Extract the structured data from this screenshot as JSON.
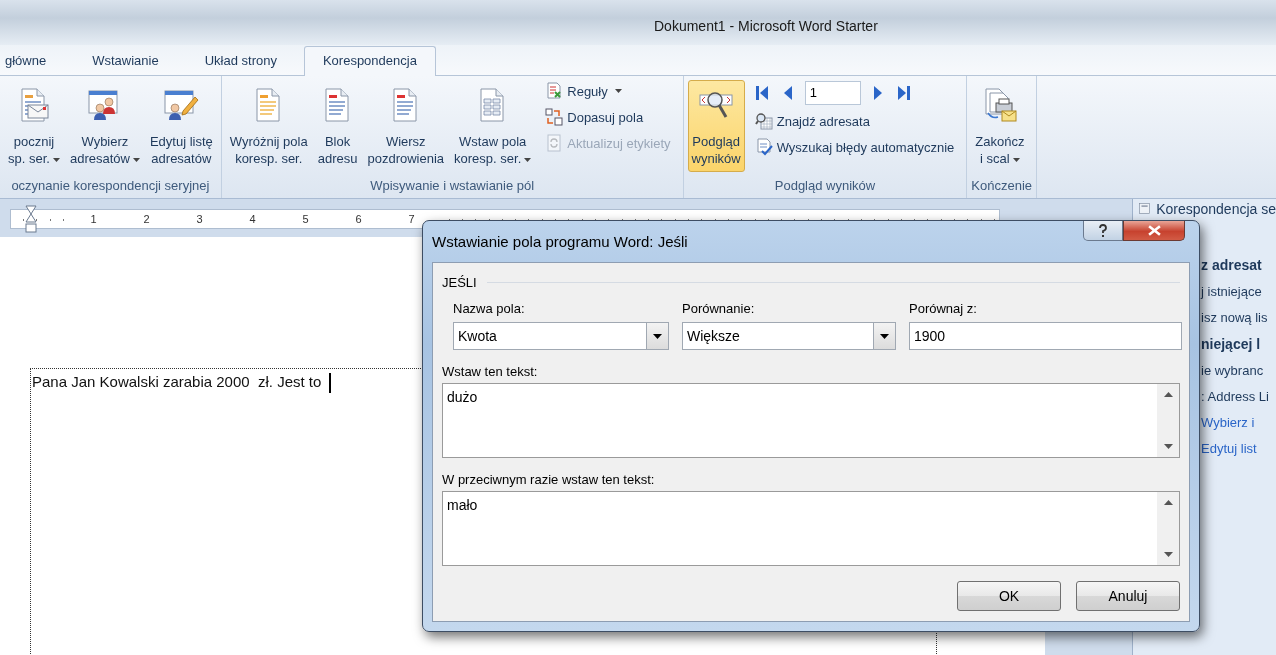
{
  "window": {
    "title": "Dokument1  -  Microsoft Word Starter"
  },
  "tabs": [
    {
      "label": "główne",
      "selected": false
    },
    {
      "label": "Wstawianie",
      "selected": false
    },
    {
      "label": "Układ strony",
      "selected": false
    },
    {
      "label": "Korespondencja",
      "selected": true
    }
  ],
  "ribbon": {
    "groups": [
      {
        "label": "oczynanie korespondencji seryjnej",
        "items": [
          {
            "kind": "large",
            "lines": [
              "pocznij",
              "sp. ser."
            ],
            "dropdown": true,
            "on": false
          },
          {
            "kind": "large",
            "lines": [
              "Wybierz",
              "adresatów"
            ],
            "dropdown": true,
            "on": false
          },
          {
            "kind": "large",
            "lines": [
              "Edytuj listę",
              "adresatów"
            ],
            "dropdown": false,
            "on": false
          }
        ]
      },
      {
        "label": "Wpisywanie i wstawianie pól",
        "items": [
          {
            "kind": "large",
            "lines": [
              "Wyróżnij pola",
              "koresp. ser."
            ],
            "dropdown": false,
            "on": false
          },
          {
            "kind": "large",
            "lines": [
              "Blok",
              "adresu"
            ],
            "dropdown": false,
            "on": false
          },
          {
            "kind": "large",
            "lines": [
              "Wiersz",
              "pozdrowienia"
            ],
            "dropdown": false,
            "on": false
          },
          {
            "kind": "large",
            "lines": [
              "Wstaw pola",
              "koresp. ser."
            ],
            "dropdown": true,
            "on": false
          },
          {
            "kind": "small",
            "label": "Reguły",
            "dropdown": true,
            "disabled": false
          },
          {
            "kind": "small",
            "label": "Dopasuj pola",
            "dropdown": false,
            "disabled": false
          },
          {
            "kind": "small",
            "label": "Aktualizuj etykiety",
            "dropdown": false,
            "disabled": true
          }
        ]
      },
      {
        "label": "Podgląd wyników",
        "items": [
          {
            "kind": "large",
            "lines": [
              "Podgląd",
              "wyników"
            ],
            "dropdown": false,
            "on": true
          },
          {
            "kind": "pager",
            "value": "1"
          },
          {
            "kind": "small",
            "label": "Znajdź adresata",
            "dropdown": false,
            "disabled": false
          },
          {
            "kind": "small",
            "label": "Wyszukaj błędy automatycznie",
            "dropdown": false,
            "disabled": false
          }
        ]
      },
      {
        "label": "Kończenie",
        "items": [
          {
            "kind": "large",
            "lines": [
              "Zakończ",
              "i scal"
            ],
            "dropdown": true,
            "on": false
          }
        ]
      }
    ]
  },
  "ruler": {
    "numbers": [
      "1",
      "2",
      "3",
      "4",
      "5",
      "6",
      "7"
    ]
  },
  "document": {
    "text": "Pana Jan Kowalski zarabia 2000  zł. Jest to"
  },
  "task_pane": {
    "title": "Korespondencja se",
    "lines": [
      {
        "kind": "heading",
        "text": "z adresat"
      },
      {
        "kind": "text",
        "text": "j istniejące"
      },
      {
        "kind": "text",
        "text": "isz nową lis"
      },
      {
        "kind": "heading",
        "text": "niejącej l"
      },
      {
        "kind": "text",
        "text": "ie wybranc"
      },
      {
        "kind": "text",
        "text": ": Address Li"
      },
      {
        "kind": "link",
        "text": "Wybierz i"
      },
      {
        "kind": "link",
        "text": "Edytuj list"
      }
    ]
  },
  "dialog": {
    "title": "Wstawianie pola programu Word: Jeśli",
    "group_label": "JEŚLI",
    "fields": [
      {
        "kind": "combo",
        "label": "Nazwa pola:",
        "value": "Kwota"
      },
      {
        "kind": "combo",
        "label": "Porównanie:",
        "value": "Większe"
      },
      {
        "kind": "text",
        "label": "Porównaj z:",
        "value": "1900"
      }
    ],
    "text_areas": [
      {
        "label": "Wstaw ten tekst:",
        "value": "dużo"
      },
      {
        "label": "W przeciwnym razie wstaw ten tekst:",
        "value": "mało"
      }
    ],
    "buttons": [
      "OK",
      "Anuluj"
    ]
  }
}
